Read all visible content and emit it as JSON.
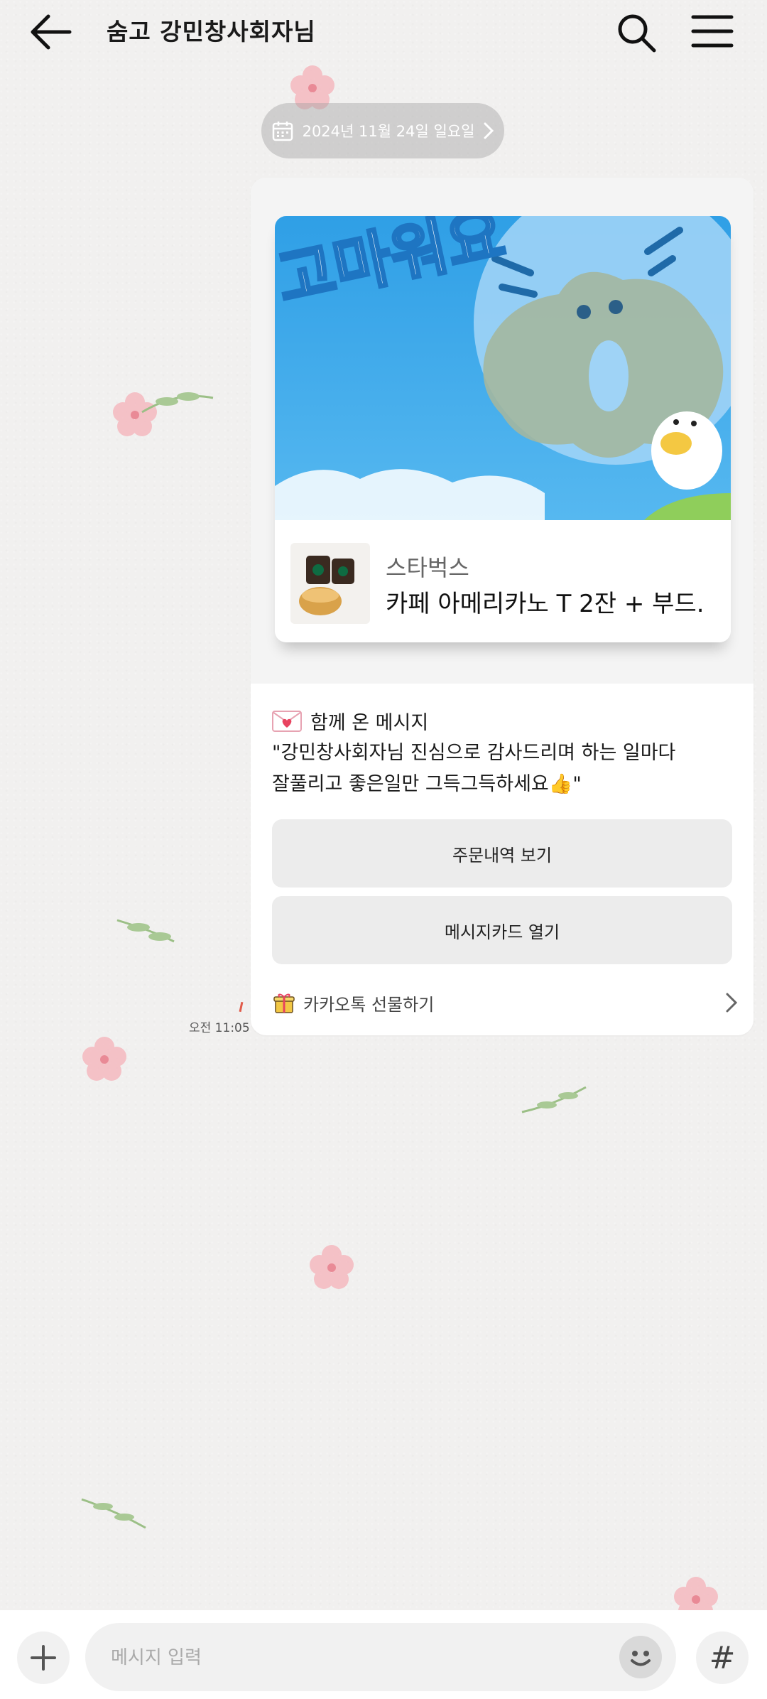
{
  "header": {
    "title": "숨고 강민창사회자님",
    "back_icon": "arrow-left-icon",
    "search_icon": "search-icon",
    "menu_icon": "menu-icon"
  },
  "date_divider": {
    "text": "2024년 11월 24일 일요일"
  },
  "gift_message": {
    "card_image_text": "고마워요",
    "brand": "스타벅스",
    "product": "카페 아메리카노 T 2잔 + 부드.",
    "message_title": "함께 온 메시지",
    "message_line1": "\"강민창사회자님 진심으로 감사드리며 하는 일마다",
    "message_line2": "잘풀리고 좋은일만 그득그득하세요👍\"",
    "button_order": "주문내역 보기",
    "button_card": "메시지카드 열기",
    "footer_label": "카카오톡 선물하기",
    "time": "오전 11:05"
  },
  "composer": {
    "placeholder": "메시지 입력",
    "hash_label": "#"
  },
  "colors": {
    "background": "#f1f0ef",
    "card_sky": "#3aa7ea",
    "button_bg": "#ececec"
  }
}
